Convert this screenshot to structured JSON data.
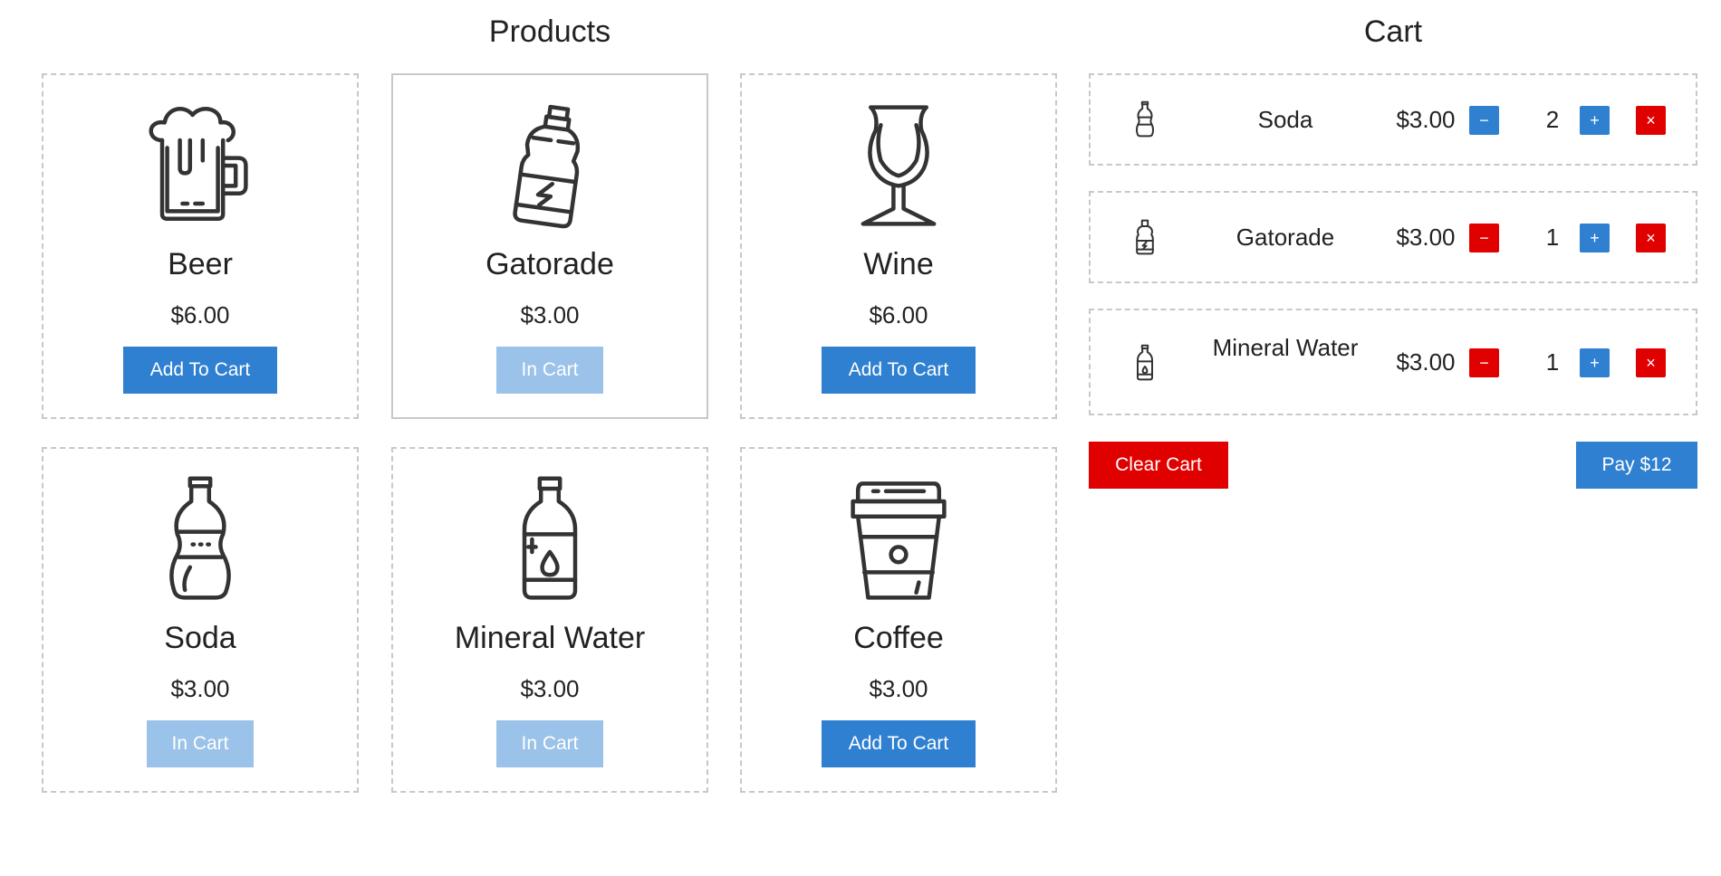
{
  "titles": {
    "products": "Products",
    "cart": "Cart"
  },
  "products": [
    {
      "name": "Beer",
      "price": "$6.00",
      "button": "Add To Cart",
      "icon": "beer-mug-icon",
      "in_cart": false
    },
    {
      "name": "Gatorade",
      "price": "$3.00",
      "button": "In Cart",
      "icon": "sports-bottle-icon",
      "in_cart": true
    },
    {
      "name": "Wine",
      "price": "$6.00",
      "button": "Add To Cart",
      "icon": "wine-glass-icon",
      "in_cart": false
    },
    {
      "name": "Soda",
      "price": "$3.00",
      "button": "In Cart",
      "icon": "soda-bottle-icon",
      "in_cart": true
    },
    {
      "name": "Mineral Water",
      "price": "$3.00",
      "button": "In Cart",
      "icon": "water-bottle-icon",
      "in_cart": true
    },
    {
      "name": "Coffee",
      "price": "$3.00",
      "button": "Add To Cart",
      "icon": "coffee-cup-icon",
      "in_cart": false
    }
  ],
  "cart": {
    "items": [
      {
        "name": "Soda",
        "price": "$3.00",
        "qty": "2",
        "icon": "soda-bottle-icon",
        "minus_enabled": true
      },
      {
        "name": "Gatorade",
        "price": "$3.00",
        "qty": "1",
        "icon": "sports-bottle-icon",
        "minus_enabled": false
      },
      {
        "name": "Mineral Water",
        "price": "$3.00",
        "qty": "1",
        "icon": "water-bottle-icon",
        "minus_enabled": false
      }
    ],
    "minus_label": "−",
    "plus_label": "+",
    "remove_label": "×",
    "clear_label": "Clear Cart",
    "pay_label": "Pay $12"
  },
  "colors": {
    "primary": "#2f80d0",
    "primary_disabled": "#9bc2e9",
    "danger": "#e00000",
    "border": "#c8c8c8"
  }
}
